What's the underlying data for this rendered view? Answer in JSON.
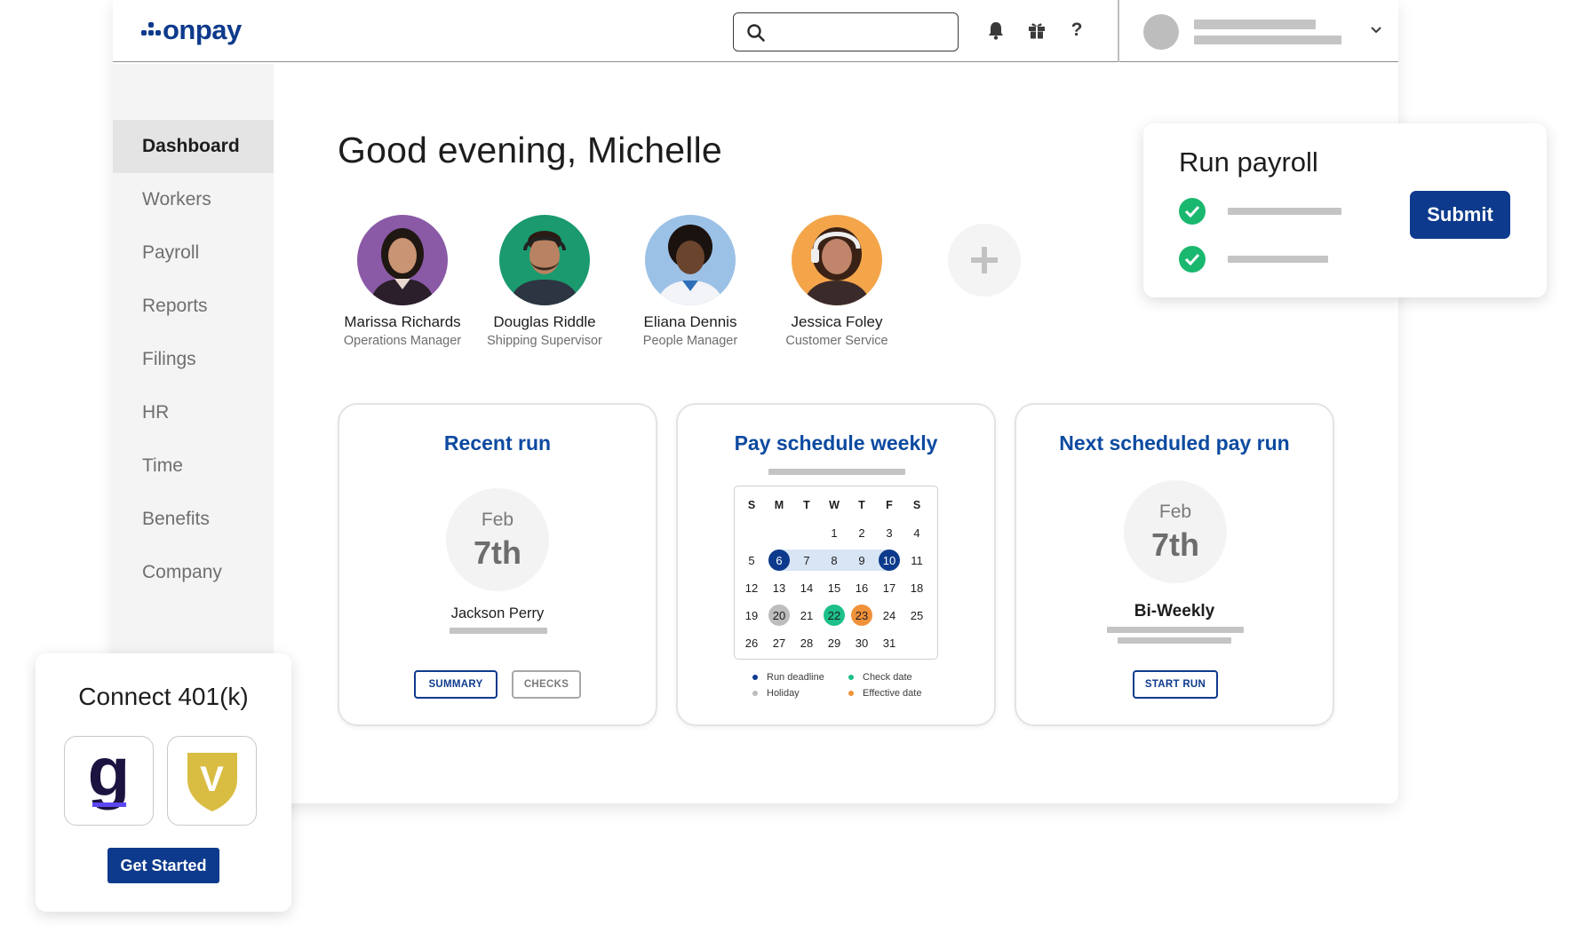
{
  "brand": {
    "logo_text": "onpay",
    "color": "#0d3a8c"
  },
  "header": {
    "search": {
      "placeholder": "",
      "value": ""
    },
    "icons": [
      "bell-icon",
      "gift-icon",
      "help-icon"
    ],
    "help_glyph": "?"
  },
  "sidebar": {
    "items": [
      {
        "label": "Dashboard",
        "active": true
      },
      {
        "label": "Workers"
      },
      {
        "label": "Payroll"
      },
      {
        "label": "Reports"
      },
      {
        "label": "Filings"
      },
      {
        "label": "HR"
      },
      {
        "label": "Time"
      },
      {
        "label": "Benefits"
      },
      {
        "label": "Company"
      }
    ]
  },
  "greeting": "Good evening, Michelle",
  "people": [
    {
      "name": "Marissa Richards",
      "role": "Operations Manager"
    },
    {
      "name": "Douglas Riddle",
      "role": "Shipping Supervisor"
    },
    {
      "name": "Eliana Dennis",
      "role": "People Manager"
    },
    {
      "name": "Jessica Foley",
      "role": "Customer Service"
    }
  ],
  "recent_run": {
    "title": "Recent run",
    "month": "Feb",
    "day": "7th",
    "person": "Jackson Perry",
    "summary_button": "SUMMARY",
    "checks_button": "CHECKS"
  },
  "pay_schedule": {
    "title": "Pay schedule weekly",
    "weekdays": [
      "S",
      "M",
      "T",
      "W",
      "T",
      "F",
      "S"
    ],
    "weeks": [
      [
        "",
        "",
        "",
        "1",
        "2",
        "3",
        "4"
      ],
      [
        "5",
        "6",
        "7",
        "8",
        "9",
        "10",
        "11"
      ],
      [
        "12",
        "13",
        "14",
        "15",
        "16",
        "17",
        "18"
      ],
      [
        "19",
        "20",
        "21",
        "22",
        "23",
        "24",
        "25"
      ],
      [
        "26",
        "27",
        "28",
        "29",
        "30",
        "31",
        ""
      ]
    ],
    "legend": {
      "run_deadline": "Run deadline",
      "holiday": "Holiday",
      "check_date": "Check date",
      "effective_date": "Effective date"
    },
    "colors": {
      "run_deadline": "#0d3a8c",
      "holiday": "#bdbdbd",
      "check_date": "#1dc08a",
      "effective_date": "#f0923a",
      "period": "#d8e5f5"
    }
  },
  "next_run": {
    "title": "Next scheduled pay run",
    "month": "Feb",
    "day": "7th",
    "frequency": "Bi-Weekly",
    "start_button": "START RUN"
  },
  "run_payroll": {
    "title": "Run payroll",
    "submit_label": "Submit"
  },
  "connect_401k": {
    "title": "Connect 401(k)",
    "guideline_letter": "g",
    "vestwell_letter": "V",
    "cta_label": "Get Started"
  }
}
